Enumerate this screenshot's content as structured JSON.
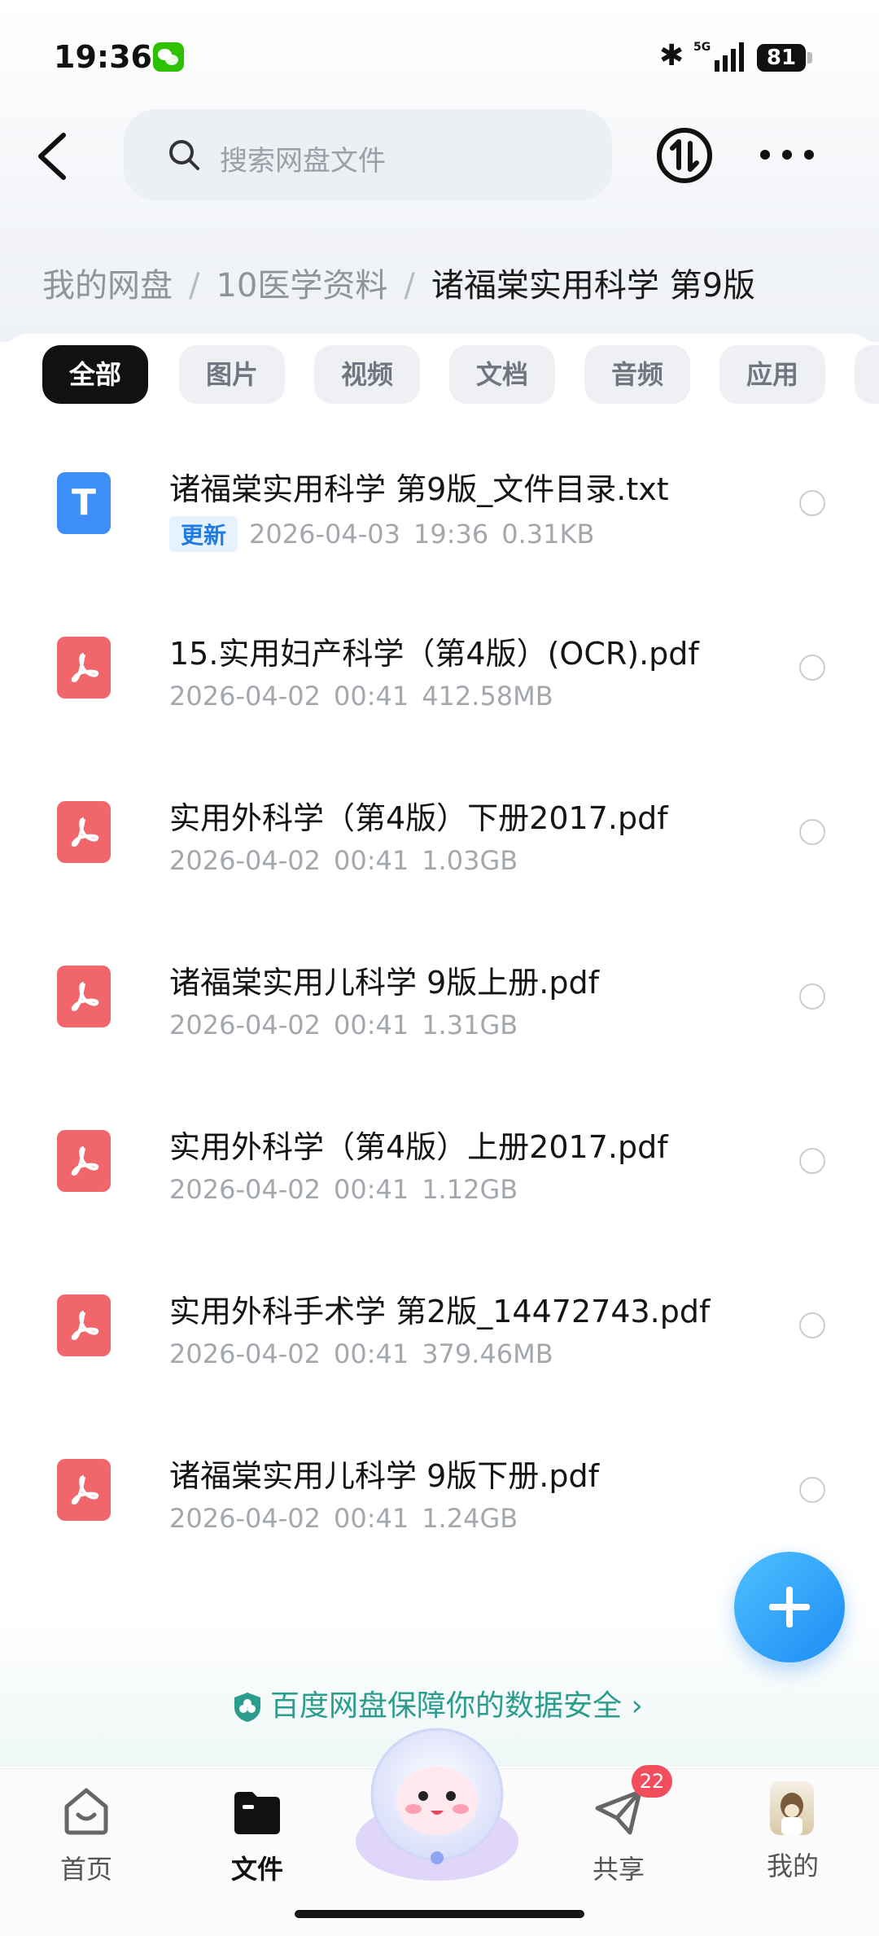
{
  "status_bar": {
    "time": "19:36",
    "battery": "81"
  },
  "search": {
    "placeholder": "搜索网盘文件"
  },
  "breadcrumb": {
    "root": "我的网盘",
    "parent": "10医学资料",
    "current": "诸福棠实用科学 第9版",
    "separator": "/"
  },
  "filters": [
    "全部",
    "图片",
    "视频",
    "文档",
    "音频",
    "应用"
  ],
  "files": [
    {
      "icon": "txt-file-icon",
      "name": "诸福棠实用科学 第9版_文件目录.txt",
      "badge": "更新",
      "date": "2026-04-03",
      "time": "19:36",
      "size": "0.31KB"
    },
    {
      "icon": "pdf-file-icon",
      "name": "15.实用妇产科学（第4版）(OCR).pdf",
      "date": "2026-04-02",
      "time": "00:41",
      "size": "412.58MB"
    },
    {
      "icon": "pdf-file-icon",
      "name": "实用外科学（第4版）下册2017.pdf",
      "date": "2026-04-02",
      "time": "00:41",
      "size": "1.03GB"
    },
    {
      "icon": "pdf-file-icon",
      "name": "诸福棠实用儿科学 9版上册.pdf",
      "date": "2026-04-02",
      "time": "00:41",
      "size": "1.31GB"
    },
    {
      "icon": "pdf-file-icon",
      "name": "实用外科学（第4版）上册2017.pdf",
      "date": "2026-04-02",
      "time": "00:41",
      "size": "1.12GB"
    },
    {
      "icon": "pdf-file-icon",
      "name": "实用外科手术学  第2版_14472743.pdf",
      "date": "2026-04-02",
      "time": "00:41",
      "size": "379.46MB"
    },
    {
      "icon": "pdf-file-icon",
      "name": "诸福棠实用儿科学 9版下册.pdf",
      "date": "2026-04-02",
      "time": "00:41",
      "size": "1.24GB"
    }
  ],
  "security": {
    "text": "百度网盘保障你的数据安全",
    "arrow": "›"
  },
  "nav": {
    "home": "首页",
    "files": "文件",
    "share": "共享",
    "mine": "我的",
    "share_badge": "22"
  },
  "colors": {
    "accent": "#1c8cf5",
    "pdf": "#f0666b",
    "txt": "#3d8ef7",
    "secure": "#2a9d8f",
    "badge": "#f24d5d"
  }
}
